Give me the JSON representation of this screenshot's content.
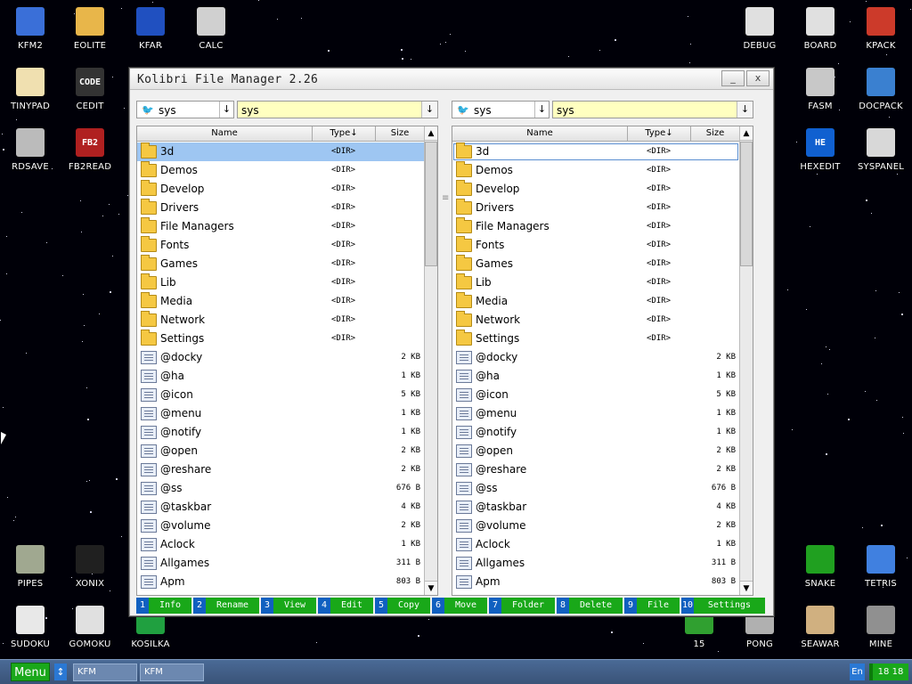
{
  "desktop": {
    "icons": [
      {
        "label": "KFM2",
        "icon": "floppy-disk-icon",
        "color": "#3a6fd8"
      },
      {
        "label": "EOLITE",
        "icon": "folder-icon",
        "color": "#e8b64a"
      },
      {
        "label": "KFAR",
        "icon": "far-manager-icon",
        "color": "#2050c0"
      },
      {
        "label": "CALC",
        "icon": "calculator-icon",
        "color": "#d0d0d0"
      },
      {
        "label": "DEBUG",
        "icon": "bug-icon",
        "color": "#e0e0e0"
      },
      {
        "label": "BOARD",
        "icon": "notepad-icon",
        "color": "#e0e0e0"
      },
      {
        "label": "KPACK",
        "icon": "wrench-icon",
        "color": "#cc3a2a"
      },
      {
        "label": "TINYPAD",
        "icon": "pencil-icon",
        "color": "#f0e0b0"
      },
      {
        "label": "CEDIT",
        "icon": "code-icon",
        "color": "#333333",
        "text": "CODE"
      },
      {
        "label": "FASM",
        "icon": "chip-icon",
        "color": "#c8c8c8"
      },
      {
        "label": "DOCPACK",
        "icon": "docpack-icon",
        "color": "#3a80d0"
      },
      {
        "label": "RDSAVE",
        "icon": "ram-disk-icon",
        "color": "#bbbbbb"
      },
      {
        "label": "FB2READ",
        "icon": "book-icon",
        "color": "#b02020",
        "text": "FB2"
      },
      {
        "label": "HEXEDIT",
        "icon": "hex-icon",
        "color": "#1060d0",
        "text": "HE"
      },
      {
        "label": "SYSPANEL",
        "icon": "sliders-icon",
        "color": "#d8d8d8"
      },
      {
        "label": "PIPES",
        "icon": "pipes-icon",
        "color": "#a0a890"
      },
      {
        "label": "XONIX",
        "icon": "xonix-icon",
        "color": "#202020"
      },
      {
        "label": "SNAKE",
        "icon": "snake-icon",
        "color": "#20a020"
      },
      {
        "label": "TETRIS",
        "icon": "tetris-icon",
        "color": "#4080e0"
      },
      {
        "label": "SUDOKU",
        "icon": "sudoku-icon",
        "color": "#e8e8e8"
      },
      {
        "label": "GOMOKU",
        "icon": "gomoku-icon",
        "color": "#e0e0e0"
      },
      {
        "label": "KOSILKA",
        "icon": "mower-icon",
        "color": "#20a040"
      },
      {
        "label": "15",
        "icon": "fifteen-icon",
        "color": "#30a030"
      },
      {
        "label": "PONG",
        "icon": "pong-icon",
        "color": "#b0b0b0"
      },
      {
        "label": "SEAWAR",
        "icon": "ship-icon",
        "color": "#d0b080"
      },
      {
        "label": "MINE",
        "icon": "mine-icon",
        "color": "#909090"
      }
    ]
  },
  "window": {
    "title": "Kolibri File Manager 2.26",
    "minimize": "_",
    "close": "x"
  },
  "panels": [
    {
      "drive": "sys",
      "path": "sys",
      "columns": {
        "name": "Name",
        "type": "Type↓",
        "size": "Size"
      },
      "selected_index": 0
    },
    {
      "drive": "sys",
      "path": "sys",
      "columns": {
        "name": "Name",
        "type": "Type↓",
        "size": "Size"
      },
      "selected_index": 0
    }
  ],
  "entries": [
    {
      "name": "3d",
      "type": "<DIR>",
      "size": "",
      "kind": "dir"
    },
    {
      "name": "Demos",
      "type": "<DIR>",
      "size": "",
      "kind": "dir"
    },
    {
      "name": "Develop",
      "type": "<DIR>",
      "size": "",
      "kind": "dir"
    },
    {
      "name": "Drivers",
      "type": "<DIR>",
      "size": "",
      "kind": "dir"
    },
    {
      "name": "File Managers",
      "type": "<DIR>",
      "size": "",
      "kind": "dir"
    },
    {
      "name": "Fonts",
      "type": "<DIR>",
      "size": "",
      "kind": "dir"
    },
    {
      "name": "Games",
      "type": "<DIR>",
      "size": "",
      "kind": "dir"
    },
    {
      "name": "Lib",
      "type": "<DIR>",
      "size": "",
      "kind": "dir"
    },
    {
      "name": "Media",
      "type": "<DIR>",
      "size": "",
      "kind": "dir"
    },
    {
      "name": "Network",
      "type": "<DIR>",
      "size": "",
      "kind": "dir"
    },
    {
      "name": "Settings",
      "type": "<DIR>",
      "size": "",
      "kind": "dir"
    },
    {
      "name": "@docky",
      "type": "",
      "size": "2 KB",
      "kind": "file"
    },
    {
      "name": "@ha",
      "type": "",
      "size": "1 KB",
      "kind": "file"
    },
    {
      "name": "@icon",
      "type": "",
      "size": "5 KB",
      "kind": "file"
    },
    {
      "name": "@menu",
      "type": "",
      "size": "1 KB",
      "kind": "file"
    },
    {
      "name": "@notify",
      "type": "",
      "size": "1 KB",
      "kind": "file"
    },
    {
      "name": "@open",
      "type": "",
      "size": "2 KB",
      "kind": "file"
    },
    {
      "name": "@reshare",
      "type": "",
      "size": "2 KB",
      "kind": "file"
    },
    {
      "name": "@ss",
      "type": "",
      "size": "676 B",
      "kind": "file"
    },
    {
      "name": "@taskbar",
      "type": "",
      "size": "4 KB",
      "kind": "file"
    },
    {
      "name": "@volume",
      "type": "",
      "size": "2 KB",
      "kind": "file"
    },
    {
      "name": "Aclock",
      "type": "",
      "size": "1 KB",
      "kind": "file"
    },
    {
      "name": "Allgames",
      "type": "",
      "size": "311 B",
      "kind": "file"
    },
    {
      "name": "Apm",
      "type": "",
      "size": "803 B",
      "kind": "file"
    }
  ],
  "function_keys": [
    {
      "num": "1",
      "label": "Info"
    },
    {
      "num": "2",
      "label": "Rename"
    },
    {
      "num": "3",
      "label": "View"
    },
    {
      "num": "4",
      "label": "Edit"
    },
    {
      "num": "5",
      "label": "Copy"
    },
    {
      "num": "6",
      "label": "Move"
    },
    {
      "num": "7",
      "label": "Folder"
    },
    {
      "num": "8",
      "label": "Delete"
    },
    {
      "num": "9",
      "label": "File"
    },
    {
      "num": "10",
      "label": "Settings"
    }
  ],
  "taskbar": {
    "menu_label": "Menu",
    "switch_label": "↕",
    "tasks": [
      "KFM",
      "KFM"
    ],
    "lang": "En",
    "clock": "18 18"
  },
  "colors": {
    "accent_green": "#1aa81a",
    "selection": "#9ec6f2",
    "path_bg": "#ffffc0",
    "fkey_num": "#1060c0"
  }
}
